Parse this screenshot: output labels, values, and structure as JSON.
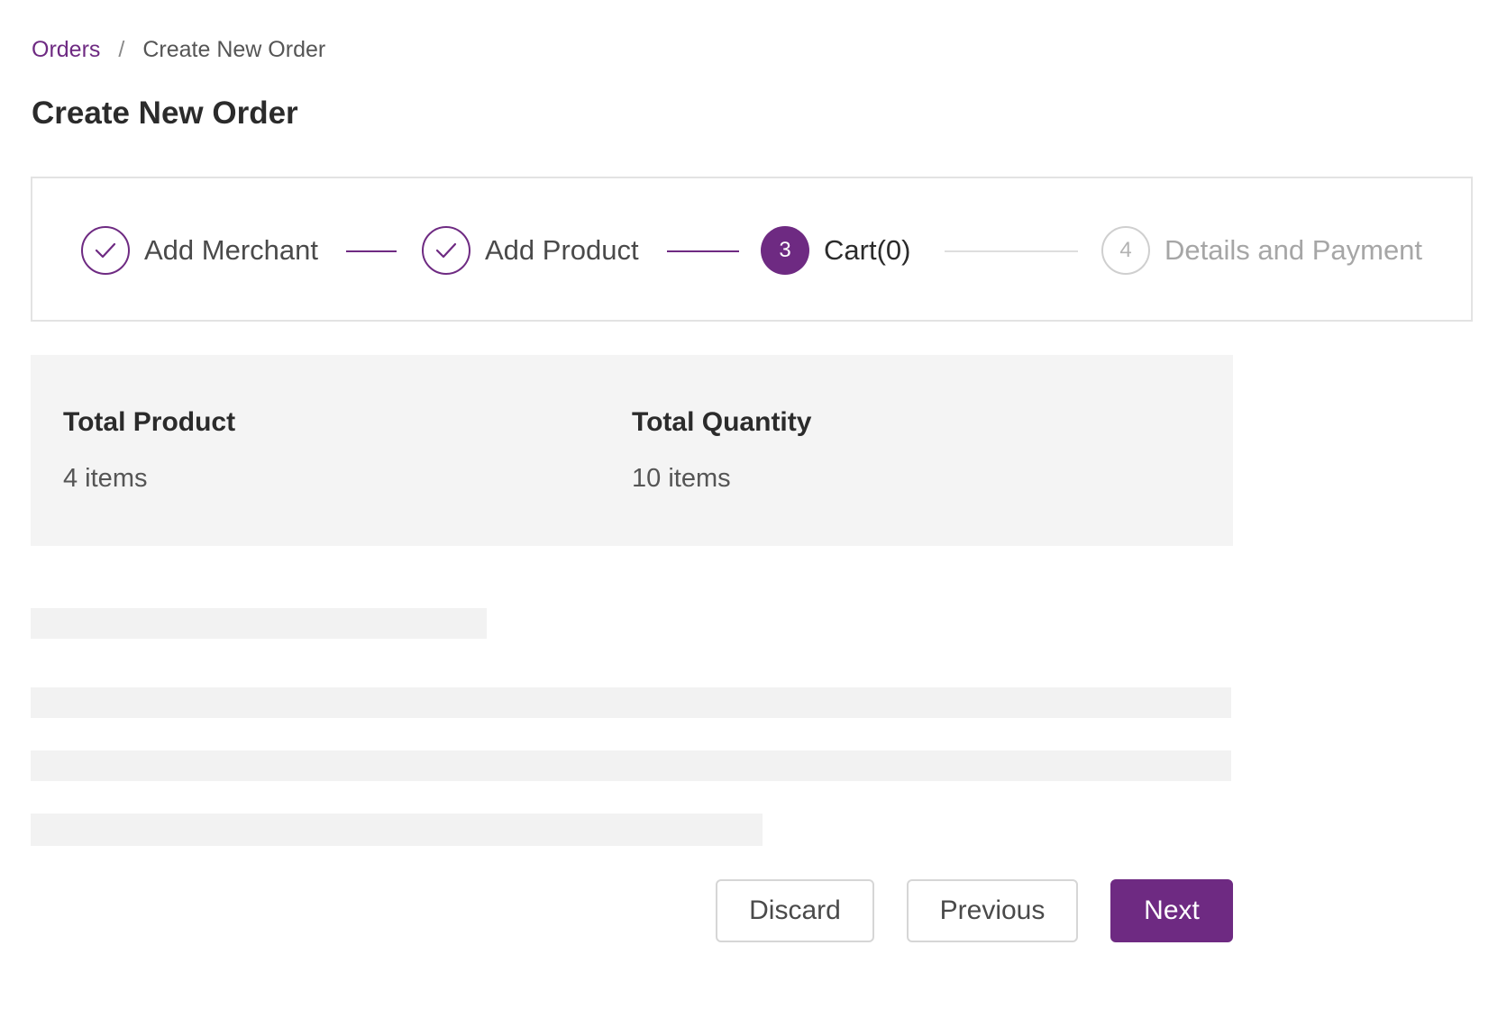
{
  "breadcrumb": {
    "parent": "Orders",
    "separator": "/",
    "current": "Create New Order"
  },
  "page_title": "Create New Order",
  "stepper": {
    "steps": [
      {
        "label": "Add Merchant",
        "status": "done",
        "icon": "check-icon"
      },
      {
        "label": "Add Product",
        "status": "done",
        "icon": "check-icon"
      },
      {
        "label": "Cart(0)",
        "status": "active",
        "number": "3"
      },
      {
        "label": "Details and Payment",
        "status": "pending",
        "number": "4"
      }
    ]
  },
  "summary": {
    "total_product_label": "Total Product",
    "total_product_value": "4 items",
    "total_quantity_label": "Total Quantity",
    "total_quantity_value": "10 items"
  },
  "actions": {
    "discard_label": "Discard",
    "previous_label": "Previous",
    "next_label": "Next"
  },
  "colors": {
    "accent": "#6e2a82",
    "panel_bg": "#f4f4f4",
    "skeleton": "#f2f2f2"
  }
}
